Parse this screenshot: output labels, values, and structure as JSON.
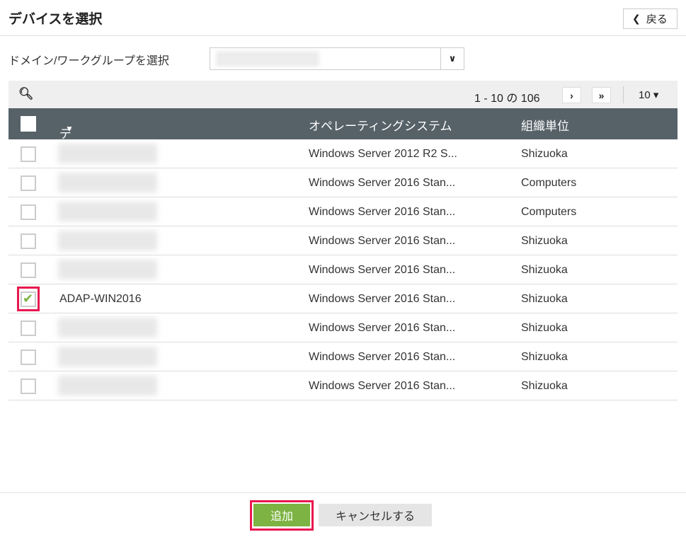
{
  "header": {
    "title": "デバイスを選択",
    "back_label": "戻る"
  },
  "domain": {
    "label": "ドメイン/ワークグループを選択"
  },
  "toolbar": {
    "range": "1 - 10 の 106",
    "per_page": "10"
  },
  "table": {
    "columns": [
      "デバイス",
      "オペレーティングシステム",
      "組織単位"
    ],
    "rows": [
      {
        "name": "",
        "os": "Windows Server 2012 R2 S...",
        "ou": "Shizuoka",
        "checked": false
      },
      {
        "name": "",
        "os": "Windows Server 2016 Stan...",
        "ou": "Computers",
        "checked": false
      },
      {
        "name": "",
        "os": "Windows Server 2016 Stan...",
        "ou": "Computers",
        "checked": false
      },
      {
        "name": "",
        "os": "Windows Server 2016 Stan...",
        "ou": "Shizuoka",
        "checked": false
      },
      {
        "name": "",
        "os": "Windows Server 2016 Stan...",
        "ou": "Shizuoka",
        "checked": false
      },
      {
        "name": "ADAP-WIN2016",
        "os": "Windows Server 2016 Stan...",
        "ou": "Shizuoka",
        "checked": true
      },
      {
        "name": "",
        "os": "Windows Server 2016 Stan...",
        "ou": "Shizuoka",
        "checked": false
      },
      {
        "name": "",
        "os": "Windows Server 2016 Stan...",
        "ou": "Shizuoka",
        "checked": false
      },
      {
        "name": "",
        "os": "Windows Server 2016 Stan...",
        "ou": "Shizuoka",
        "checked": false
      }
    ]
  },
  "footer": {
    "add_label": "追加",
    "cancel_label": "キャンセルする"
  },
  "colors": {
    "accent": "#7cb342",
    "header": "#566168",
    "highlight": "#e8174f"
  }
}
